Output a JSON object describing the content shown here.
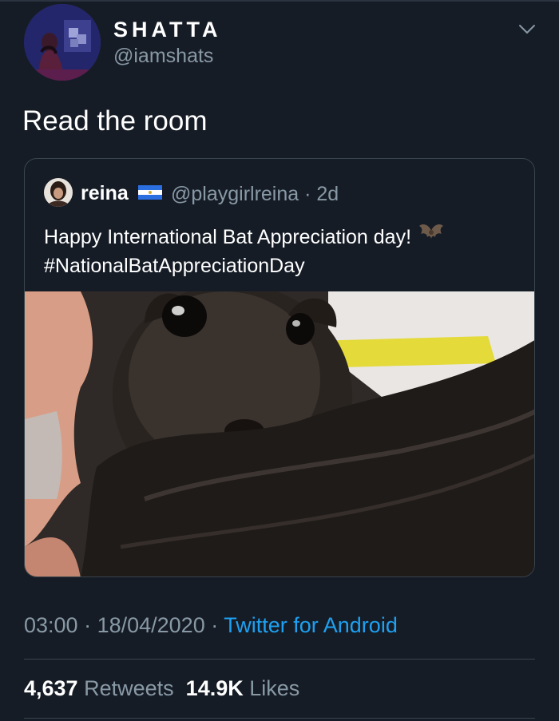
{
  "author": {
    "display_name": "SHATTA",
    "handle": "@iamshats",
    "avatar_icon": "profile-photo"
  },
  "tweet": {
    "text": "Read the room"
  },
  "quoted_tweet": {
    "name": "reina",
    "flag_icon": "flag-el-salvador-icon",
    "handle_time": "@playgirlreina · 2d",
    "text_line1": "Happy International Bat Appreciation day!",
    "text_emoji": "bat-icon",
    "text_line2": "#NationalBatAppreciationDay",
    "image_description_icon": "bat-photo"
  },
  "meta": {
    "time": "03:00",
    "sep1": " · ",
    "date": "18/04/2020",
    "sep2": " · ",
    "source": "Twitter for Android"
  },
  "stats": {
    "retweets_count": "4,637",
    "retweets_label": "Retweets",
    "likes_count": "14.9K",
    "likes_label": "Likes"
  },
  "colors": {
    "background": "#161c26",
    "secondary_text": "#8899a6",
    "link": "#1da1f2",
    "border": "#38444d"
  }
}
